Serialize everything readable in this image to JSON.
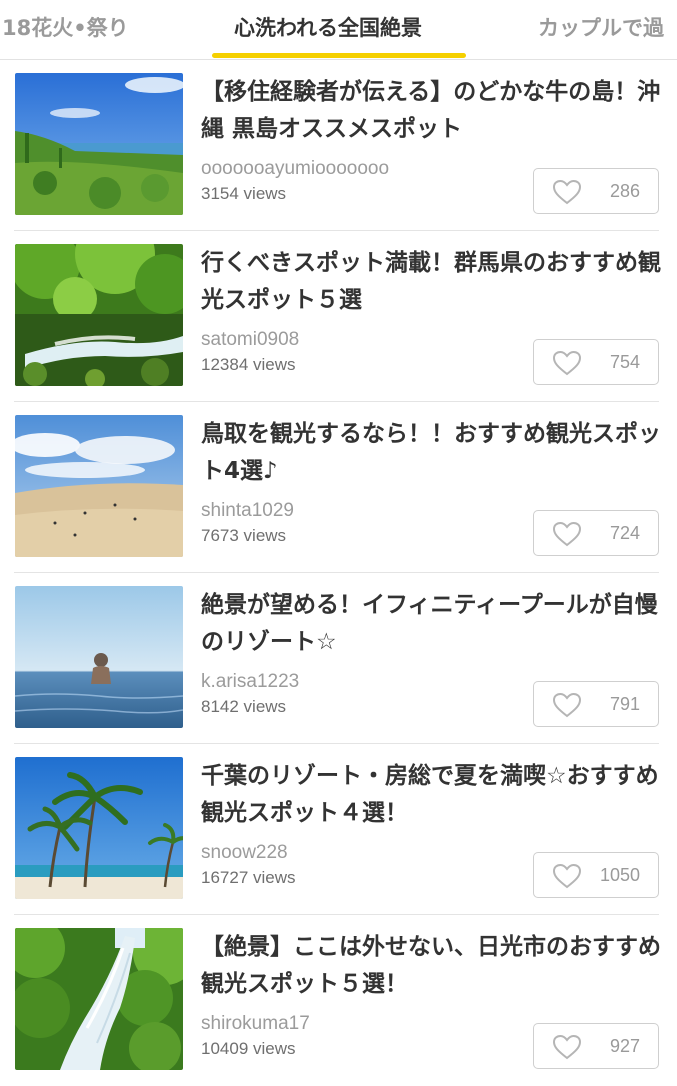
{
  "tabs": [
    {
      "label": "18花火•祭り"
    },
    {
      "label": "心洗われる全国絶景"
    },
    {
      "label": "カップルで過"
    }
  ],
  "active_tab": "心洗われる全国絶景",
  "colors": {
    "accent": "#f5d000",
    "text": "#333333",
    "muted": "#9a9a9a"
  },
  "articles": [
    {
      "title": "【移住経験者が伝える】のどかな牛の島！沖縄 黒島オススメスポット",
      "author": "ooooooayumiooooooo",
      "views": "3154 views",
      "likes": "286",
      "thumb": "grassland-island"
    },
    {
      "title": "行くべきスポット満載！群馬県のおすすめ観光スポット５選",
      "author": "satomi0908",
      "views": "12384 views",
      "likes": "754",
      "thumb": "forest-stream"
    },
    {
      "title": "鳥取を観光するなら！！おすすめ観光スポット4選♪",
      "author": "shinta1029",
      "views": "7673 views",
      "likes": "724",
      "thumb": "sand-dunes"
    },
    {
      "title": "絶景が望める！イフィニティープールが自慢のリゾート☆",
      "author": "k.arisa1223",
      "views": "8142 views",
      "likes": "791",
      "thumb": "infinity-pool"
    },
    {
      "title": "千葉のリゾート・房総で夏を満喫☆おすすめ観光スポット４選！",
      "author": "snoow228",
      "views": "16727 views",
      "likes": "1050",
      "thumb": "palm-beach"
    },
    {
      "title": "【絶景】ここは外せない、日光市のおすすめ観光スポット５選！",
      "author": "shirokuma17",
      "views": "10409 views",
      "likes": "927",
      "thumb": "waterfall"
    }
  ]
}
